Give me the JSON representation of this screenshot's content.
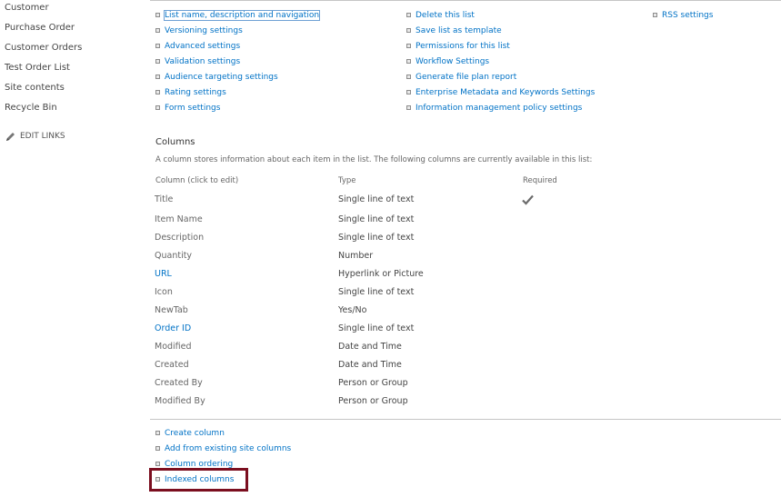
{
  "leftnav": {
    "items": [
      "Customer",
      "Purchase Order",
      "Customer Orders",
      "Test Order List",
      "Site contents",
      "Recycle Bin"
    ],
    "edit_links": "EDIT LINKS"
  },
  "general_settings": {
    "col1": [
      "List name, description and navigation",
      "Versioning settings",
      "Advanced settings",
      "Validation settings",
      "Audience targeting settings",
      "Rating settings",
      "Form settings"
    ],
    "col2": [
      "Delete this list",
      "Save list as template",
      "Permissions for this list",
      "Workflow Settings",
      "Generate file plan report",
      "Enterprise Metadata and Keywords Settings",
      "Information management policy settings"
    ],
    "col3": [
      "RSS settings"
    ]
  },
  "columns": {
    "heading": "Columns",
    "description": "A column stores information about each item in the list. The following columns are currently available in this list:",
    "headers": {
      "name": "Column (click to edit)",
      "type": "Type",
      "required": "Required"
    },
    "rows": [
      {
        "name": "Title",
        "type": "Single line of text",
        "required": true,
        "linked": false
      },
      {
        "name": "Item Name",
        "type": "Single line of text",
        "required": false,
        "linked": false
      },
      {
        "name": "Description",
        "type": "Single line of text",
        "required": false,
        "linked": false
      },
      {
        "name": "Quantity",
        "type": "Number",
        "required": false,
        "linked": false
      },
      {
        "name": "URL",
        "type": "Hyperlink or Picture",
        "required": false,
        "linked": true
      },
      {
        "name": "Icon",
        "type": "Single line of text",
        "required": false,
        "linked": false
      },
      {
        "name": "NewTab",
        "type": "Yes/No",
        "required": false,
        "linked": false
      },
      {
        "name": "Order ID",
        "type": "Single line of text",
        "required": false,
        "linked": true
      },
      {
        "name": "Modified",
        "type": "Date and Time",
        "required": false,
        "linked": false
      },
      {
        "name": "Created",
        "type": "Date and Time",
        "required": false,
        "linked": false
      },
      {
        "name": "Created By",
        "type": "Person or Group",
        "required": false,
        "linked": false
      },
      {
        "name": "Modified By",
        "type": "Person or Group",
        "required": false,
        "linked": false
      }
    ]
  },
  "column_actions": [
    "Create column",
    "Add from existing site columns",
    "Column ordering",
    "Indexed columns"
  ],
  "colors": {
    "link": "#0072c6",
    "highlight": "#7b0e1f"
  },
  "icons": {
    "edit": "pencil-icon",
    "required": "checkmark-icon",
    "bullet": "square-bullet-icon"
  }
}
